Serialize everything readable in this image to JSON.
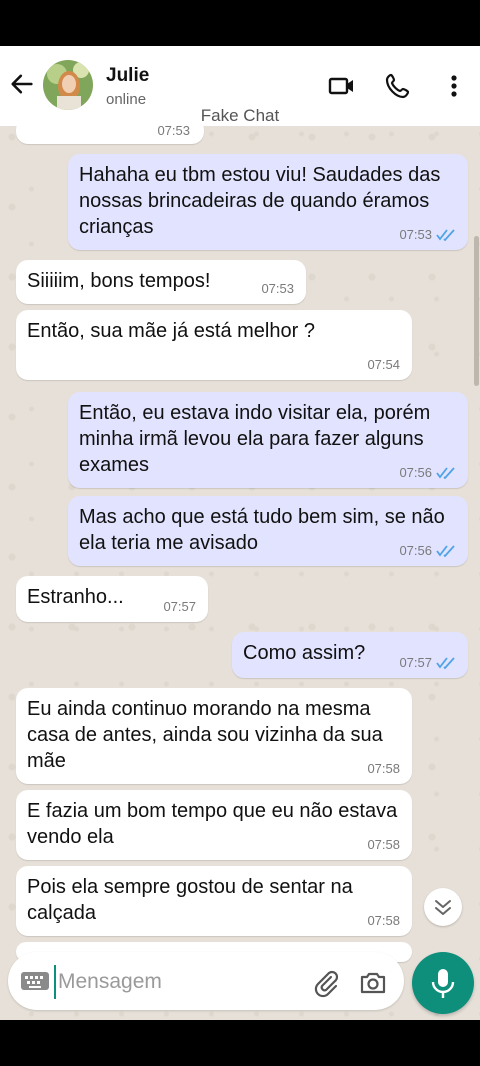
{
  "header": {
    "contact_name": "Julie",
    "contact_status": "online",
    "banner": "Fake Chat",
    "icons": [
      "back-arrow-icon",
      "video-call-icon",
      "phone-icon",
      "more-options-icon"
    ]
  },
  "partial_time": "07:53",
  "messages": [
    {
      "dir": "out",
      "text": "Hahaha eu tbm estou viu! Saudades das nossas brincadeiras de quando éramos crianças",
      "time": "07:53",
      "read": true
    },
    {
      "dir": "in",
      "text": "Siiiiim, bons tempos!",
      "time": "07:53"
    },
    {
      "dir": "in",
      "text": "Então, sua mãe já está melhor ?",
      "time": "07:54"
    },
    {
      "dir": "out",
      "text": "Então, eu estava indo visitar ela, porém minha irmã levou ela para fazer alguns exames",
      "time": "07:56",
      "read": true
    },
    {
      "dir": "out",
      "text": "Mas acho que está tudo bem sim, se não ela teria me avisado",
      "time": "07:56",
      "read": true
    },
    {
      "dir": "in",
      "text": "Estranho...",
      "time": "07:57"
    },
    {
      "dir": "out",
      "text": "Como assim?",
      "time": "07:57",
      "read": true
    },
    {
      "dir": "in",
      "text": "Eu ainda continuo morando na mesma casa de antes, ainda sou vizinha da sua mãe",
      "time": "07:58"
    },
    {
      "dir": "in",
      "text": "E fazia um bom tempo que eu não estava vendo ela",
      "time": "07:58"
    },
    {
      "dir": "in",
      "text": "Pois ela sempre gostou de sentar na calçada",
      "time": "07:58"
    }
  ],
  "composer": {
    "placeholder": "Mensagem",
    "icons": [
      "keyboard-icon",
      "attach-icon",
      "camera-icon",
      "mic-icon",
      "scroll-down-icon"
    ]
  },
  "colors": {
    "accent": "#0d8f7c",
    "outgoing_bubble": "#e2e3ff",
    "incoming_bubble": "#ffffff",
    "read_ticks": "#4fa3e6",
    "wallpaper": "#e6e0d8"
  }
}
